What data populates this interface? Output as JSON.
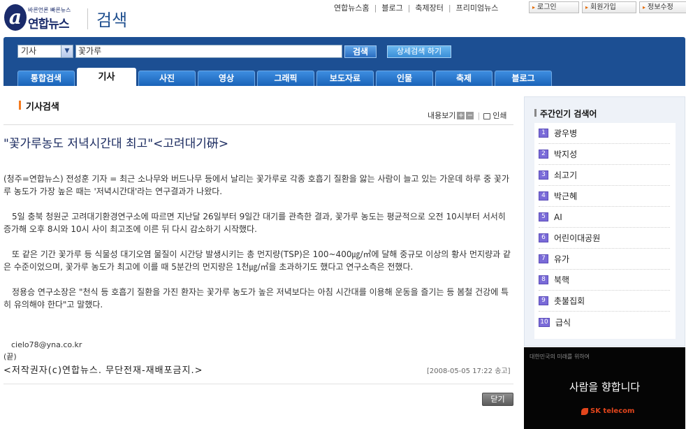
{
  "header": {
    "logo_letter": "a",
    "logo_slogan": "바른언론 빠른뉴스",
    "logo_name": "연합뉴스",
    "page_title": "검색",
    "links": [
      "연합뉴스홈",
      "블로그",
      "축제장터",
      "프리미엄뉴스"
    ],
    "buttons": [
      "로그인",
      "회원가입",
      "정보수정"
    ]
  },
  "search": {
    "category": "기사",
    "query": "꽃가루",
    "search_label": "검색",
    "advanced_label": "상세검색 하기"
  },
  "tabs": [
    "통합검색",
    "기사",
    "사진",
    "영상",
    "그래픽",
    "보도자료",
    "인물",
    "축제",
    "블로그"
  ],
  "active_tab": "기사",
  "content": {
    "section_title": "기사검색",
    "tools_view": "내용보기",
    "tools_plus": "+",
    "tools_minus": "−",
    "tools_print": "인쇄",
    "headline": "\"꽃가루농도 저녁시간대 최고\"<고려대기硏>",
    "paragraphs": [
      "(청주=연합뉴스) 전성훈 기자 = 최근 소나무와 버드나무 등에서 날리는 꽃가루로 각종 호흡기 질환을 앓는 사람이 늘고 있는 가운데 하루 중 꽃가루 농도가 가장 높은 때는 '저녁시간대'라는 연구결과가 나왔다.",
      "5일 충북 청원군 고려대기환경연구소에 따르면 지난달 26일부터 9일간 대기를 관측한 결과, 꽃가루 농도는 평균적으로 오전 10시부터 서서히 증가해 오후 8시와 10시 사이 최고조에 이른 뒤 다시 감소하기 시작했다.",
      "또 같은 기간 꽃가루 등 식물성 대기오염 물질이 시간당 발생시키는 총 먼지량(TSP)은 100~400㎍/㎥에 달해 중규모 이상의 황사 먼지량과 같은 수준이었으며, 꽃가루 농도가 최고에 이를 때 5분간의 먼지량은 1천㎍/㎥을 초과하기도 했다고 연구소측은 전했다.",
      "정용승 연구소장은 \"천식 등 호흡기 질환을 가진 환자는 꽃가루 농도가 높은 저녁보다는 아침 시간대를 이용해 운동을 즐기는 등 봄철 건강에 특히 유의해야 한다\"고 말했다."
    ],
    "contact": "cielo78@yna.co.kr",
    "end_mark": "(끝)",
    "copyright": "<저작권자(c)연합뉴스. 무단전재-재배포금지.>",
    "datetime": "[2008-05-05 17:22 송고]",
    "close_label": "닫기"
  },
  "sidebar": {
    "title": "주간인기 검색어",
    "items": [
      {
        "rank": "1",
        "label": "광우병"
      },
      {
        "rank": "2",
        "label": "박지성"
      },
      {
        "rank": "3",
        "label": "쇠고기"
      },
      {
        "rank": "4",
        "label": "박근혜"
      },
      {
        "rank": "5",
        "label": "AI"
      },
      {
        "rank": "6",
        "label": "어린이대공원"
      },
      {
        "rank": "7",
        "label": "유가"
      },
      {
        "rank": "8",
        "label": "북핵"
      },
      {
        "rank": "9",
        "label": "촛불집회"
      },
      {
        "rank": "10",
        "label": "급식"
      }
    ]
  },
  "ad": {
    "top_text": "대한민국의 미래를 위하여",
    "slogan": "사람을 향합니다",
    "brand": "SK telecom"
  },
  "colors": {
    "nav_blue": "#1c4f93",
    "accent_orange": "#f47b20",
    "rank_badge": "#7a6bd8"
  }
}
